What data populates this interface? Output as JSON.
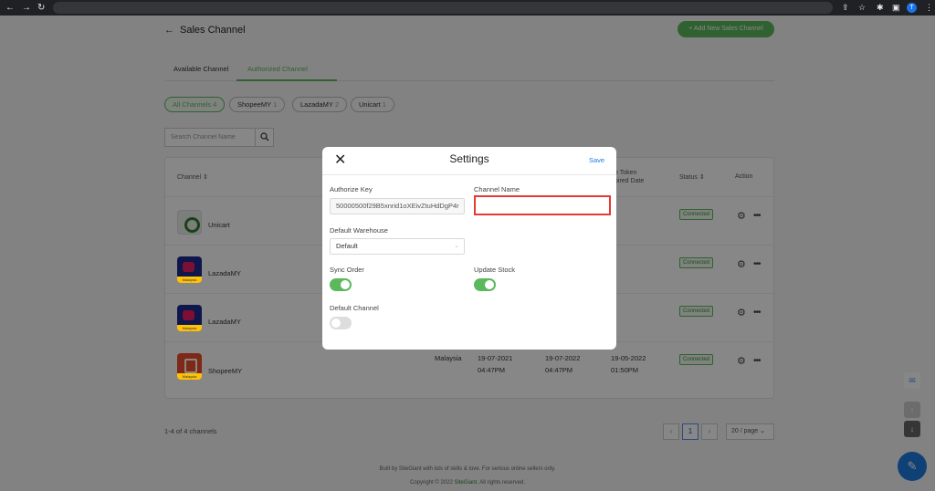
{
  "page": {
    "title": "Sales Channel",
    "add_button": "+ Add New Sales Channel"
  },
  "tabs": [
    "Available Channel",
    "Authorized Channel"
  ],
  "filters": [
    {
      "label": "All Channels",
      "count": "4"
    },
    {
      "label": "ShopeeMY",
      "count": "1"
    },
    {
      "label": "LazadaMY",
      "count": "2"
    },
    {
      "label": "Unicart",
      "count": "1"
    }
  ],
  "search": {
    "placeholder": "Search Channel Name"
  },
  "table": {
    "headers": {
      "channel": "Channel ⇕",
      "token": "h Token",
      "token_2": "pired Date",
      "status": "Status ⇕",
      "action": "Action"
    },
    "rows": [
      {
        "name": "Unicart",
        "status": "Connected",
        "logo_tag": ""
      },
      {
        "name": "LazadaMY",
        "status": "Connected",
        "logo_tag": "Malaysia"
      },
      {
        "name": "LazadaMY",
        "status": "Connected",
        "logo_tag": "Malaysia"
      },
      {
        "name": "ShopeeMY",
        "status": "Connected",
        "logo_tag": "Malaysia",
        "region": "Malaysia",
        "date1": "19-07-2021",
        "time1": "04:47PM",
        "date2": "19-07-2022",
        "time2": "04:47PM",
        "date3": "19-05-2022",
        "time3": "01:50PM"
      }
    ]
  },
  "pagination": {
    "summary": "1-4 of 4 channels",
    "current_page": "1",
    "prev": "‹",
    "next": "›",
    "page_size": "20 / page"
  },
  "footer": {
    "line1": "Built by SiteGiant with lots of skills & love. For serious online sellers only.",
    "line2_prefix": "Copyright © 2022 ",
    "brand": "SiteGiant",
    "line2_suffix": ". All rights reserved."
  },
  "modal": {
    "title": "Settings",
    "close": "✕",
    "save": "Save",
    "authorize_key_label": "Authorize Key",
    "authorize_key_value": "50000500f29B5xnrid1oXEivZtuHdDgP4r",
    "channel_name_label": "Channel Name",
    "channel_name_value": "",
    "default_warehouse_label": "Default Warehouse",
    "default_warehouse_value": "Default",
    "sync_order_label": "Sync Order",
    "sync_order_on": true,
    "update_stock_label": "Update Stock",
    "update_stock_on": true,
    "default_channel_label": "Default Channel",
    "default_channel_on": false
  },
  "browser": {
    "avatar_letter": "T"
  },
  "colors": {
    "accent": "#5cb85c",
    "link": "#1e7be0",
    "highlight": "#e53935"
  }
}
